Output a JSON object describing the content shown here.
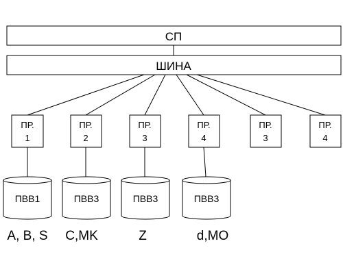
{
  "sp": {
    "label": "СП"
  },
  "bus": {
    "label": "ШИНА"
  },
  "processors": [
    {
      "line1": "ПР.",
      "line2": "1"
    },
    {
      "line1": "ПР.",
      "line2": "2"
    },
    {
      "line1": "ПР.",
      "line2": "3"
    },
    {
      "line1": "ПР.",
      "line2": "4"
    },
    {
      "line1": "ПР.",
      "line2": "3"
    },
    {
      "line1": "ПР.",
      "line2": "4"
    }
  ],
  "storages": [
    {
      "label": "ПВВ1",
      "caption": "A, B, S"
    },
    {
      "label": "ПВВ3",
      "caption": "C,MK"
    },
    {
      "label": "ПВВ3",
      "caption": "Z"
    },
    {
      "label": "ПВВ3",
      "caption": "d,MO"
    }
  ]
}
